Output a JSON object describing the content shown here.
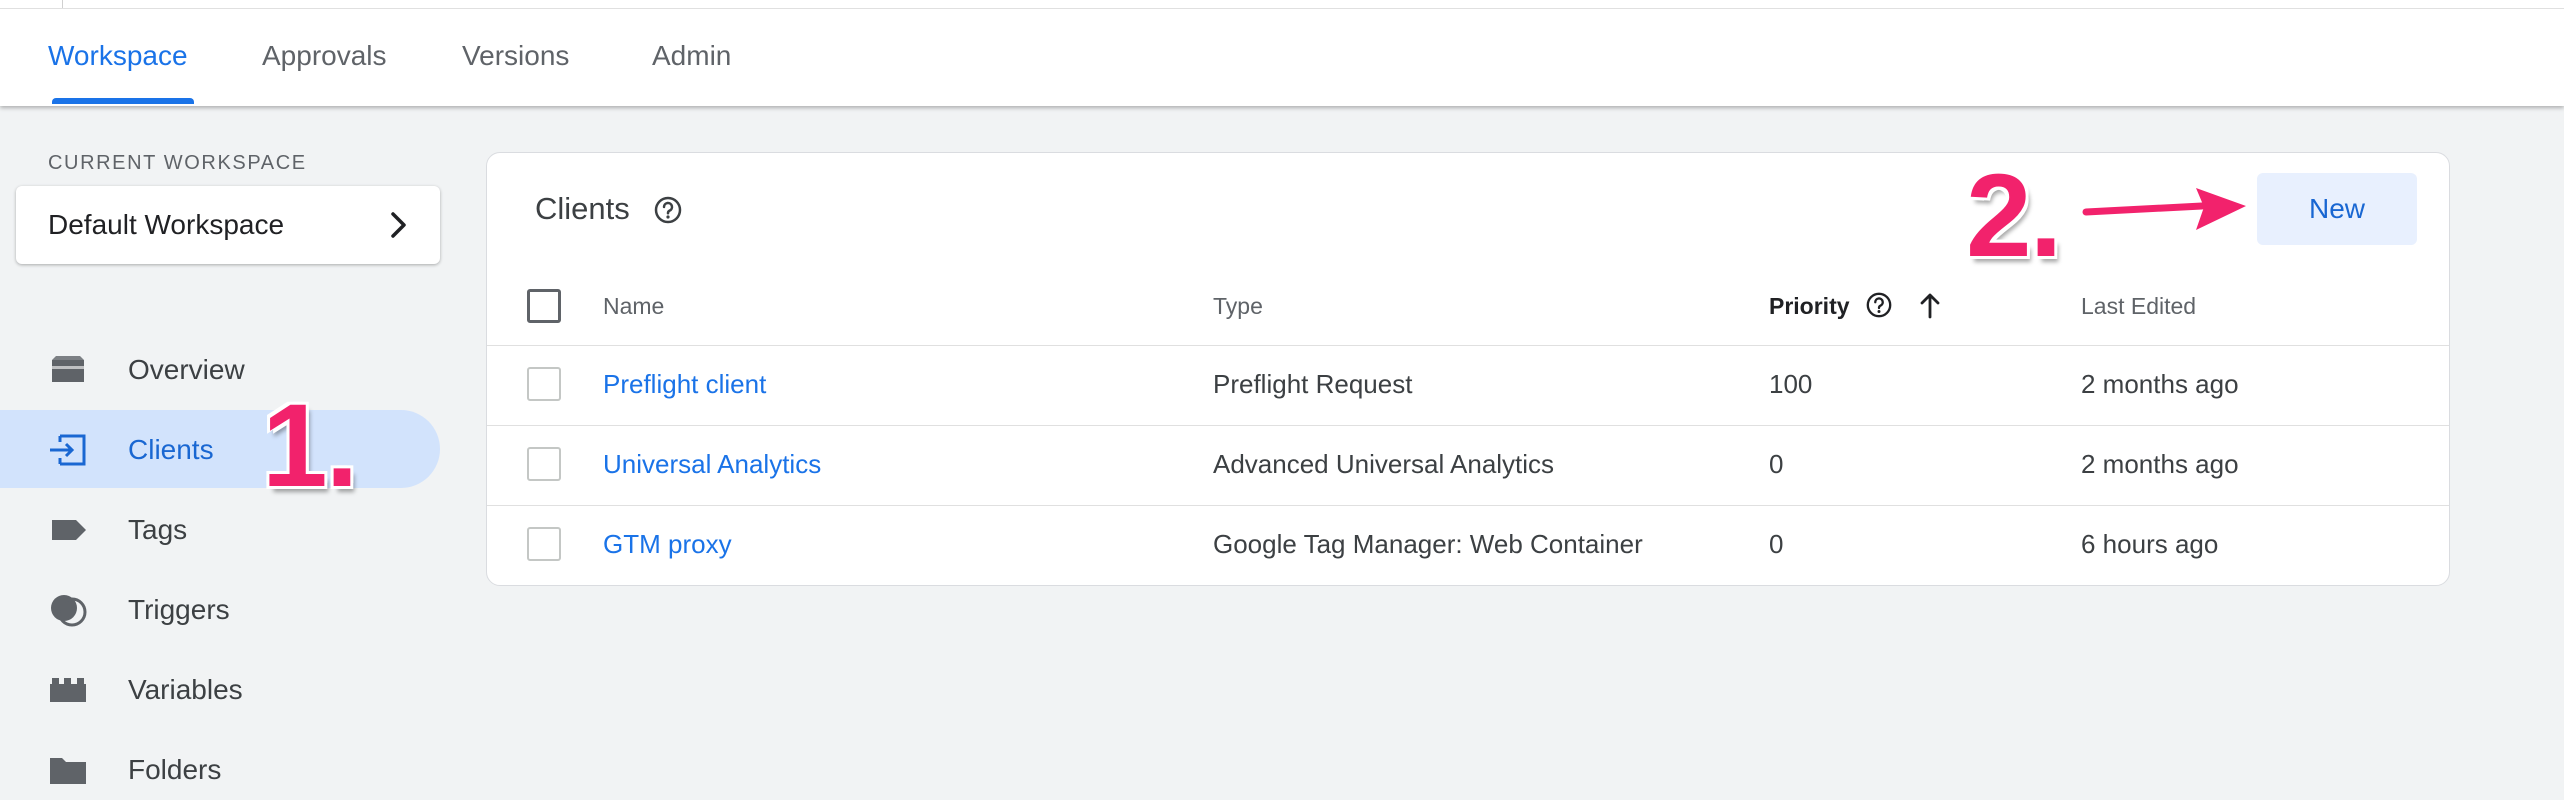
{
  "tabs": [
    {
      "label": "Workspace",
      "active": true
    },
    {
      "label": "Approvals",
      "active": false
    },
    {
      "label": "Versions",
      "active": false
    },
    {
      "label": "Admin",
      "active": false
    }
  ],
  "sidebar": {
    "workspace_label": "CURRENT WORKSPACE",
    "workspace_name": "Default Workspace",
    "items": [
      {
        "label": "Overview",
        "icon": "overview-icon",
        "active": false
      },
      {
        "label": "Clients",
        "icon": "clients-icon",
        "active": true
      },
      {
        "label": "Tags",
        "icon": "tag-icon",
        "active": false
      },
      {
        "label": "Triggers",
        "icon": "triggers-icon",
        "active": false
      },
      {
        "label": "Variables",
        "icon": "variables-icon",
        "active": false
      },
      {
        "label": "Folders",
        "icon": "folder-icon",
        "active": false
      }
    ]
  },
  "main": {
    "title": "Clients",
    "new_label": "New",
    "columns": {
      "name": "Name",
      "type": "Type",
      "priority": "Priority",
      "last_edited": "Last Edited"
    },
    "sort": {
      "column": "priority",
      "direction": "ascending",
      "icon": "arrow-up-icon"
    },
    "rows": [
      {
        "name": "Preflight client",
        "type": "Preflight Request",
        "priority": "100",
        "last_edited": "2 months ago"
      },
      {
        "name": "Universal Analytics",
        "type": "Advanced Universal Analytics",
        "priority": "0",
        "last_edited": "2 months ago"
      },
      {
        "name": "GTM proxy",
        "type": "Google Tag Manager: Web Container",
        "priority": "0",
        "last_edited": "6 hours ago"
      }
    ]
  },
  "annotations": {
    "step1": "1.",
    "step2": "2."
  },
  "colors": {
    "accent": "#1a73e8",
    "active_nav_bg": "#d2e3fc",
    "new_button_bg": "#e8f0fe",
    "annotation": "#f2226c",
    "page_bg": "#f1f3f4"
  }
}
